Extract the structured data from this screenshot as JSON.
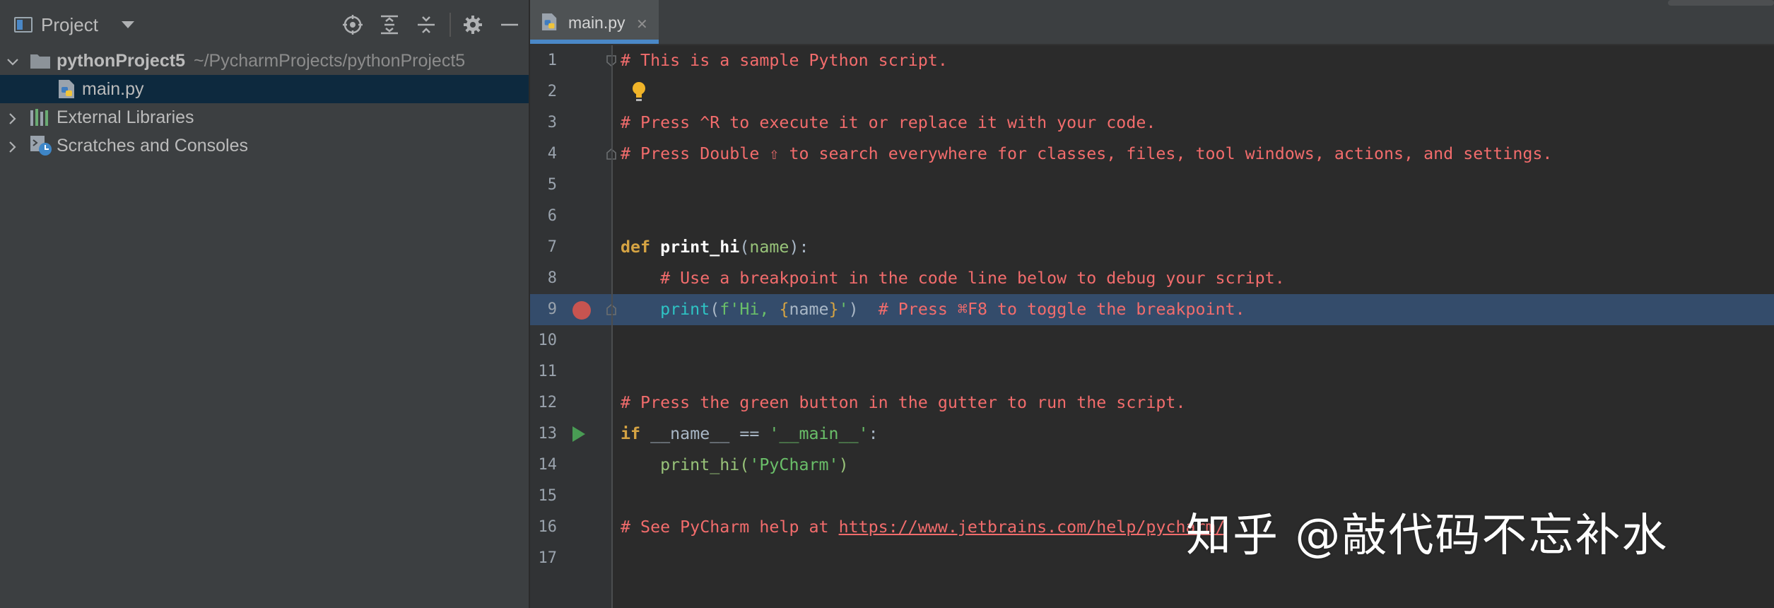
{
  "project_panel": {
    "title": "Project",
    "icons": [
      "project-view-icon",
      "chevron-down-icon",
      "locate-icon",
      "expand-all-icon",
      "collapse-all-icon",
      "gear-icon",
      "minimize-icon"
    ],
    "tree": [
      {
        "label": "pythonProject5",
        "path": "~/PycharmProjects/pythonProject5",
        "icon": "folder-icon",
        "expanded": true
      },
      {
        "label": "main.py",
        "icon": "python-file-icon",
        "selected": true
      },
      {
        "label": "External Libraries",
        "icon": "libraries-icon"
      },
      {
        "label": "Scratches and Consoles",
        "icon": "scratches-icon"
      }
    ]
  },
  "editor": {
    "tab": {
      "label": "main.py",
      "close": "✕",
      "icon": "python-file-icon"
    },
    "line_numbers": [
      "1",
      "2",
      "3",
      "4",
      "5",
      "6",
      "7",
      "8",
      "9",
      "10",
      "11",
      "12",
      "13",
      "14",
      "15",
      "16",
      "17"
    ],
    "lines": {
      "l1": "# This is a sample Python script.",
      "l3": "# Press ^R to execute it or replace it with your code.",
      "l4": "# Press Double ⇧ to search everywhere for classes, files, tool windows, actions, and settings.",
      "l7_kw": "def",
      "l7_fn": "print_hi",
      "l7_open": "(",
      "l7_param": "name",
      "l7_close": "):",
      "l8": "    # Use a breakpoint in the code line below to debug your script.",
      "l9_indent": "    ",
      "l9_print": "print",
      "l9_open": "(",
      "l9_fstr_a": "f'Hi, ",
      "l9_brace_open": "{",
      "l9_name": "name",
      "l9_brace_close": "}",
      "l9_fstr_b": "'",
      "l9_close": ")",
      "l9_comment": "  # Press ⌘F8 to toggle the breakpoint.",
      "l12": "# Press the green button in the gutter to run the script.",
      "l13_kw": "if",
      "l13_rest": " __name__ == ",
      "l13_str": "'__main__'",
      "l13_colon": ":",
      "l14_call": "    print_hi(",
      "l14_str": "'PyCharm'",
      "l14_close": ")",
      "l16_prefix": "# See PyCharm help at ",
      "l16_link": "https://www.jetbrains.com/help/pycharm/"
    },
    "highlighted_line": 9,
    "breakpoint_line": 9,
    "run_marker_line": 13,
    "intention_bulb_line": 2
  },
  "watermark": "知乎 @敲代码不忘补水",
  "colors": {
    "background": "#2b2b2b",
    "panel": "#3c3f41",
    "selection": "#0d293e",
    "line_highlight": "#344c6b",
    "comment": "#f26c6c",
    "keyword": "#d5a343",
    "string": "#6abf69",
    "builtin": "#2ec4c4",
    "breakpoint": "#c75450",
    "run": "#499c54",
    "tab_accent": "#4a88c7"
  }
}
